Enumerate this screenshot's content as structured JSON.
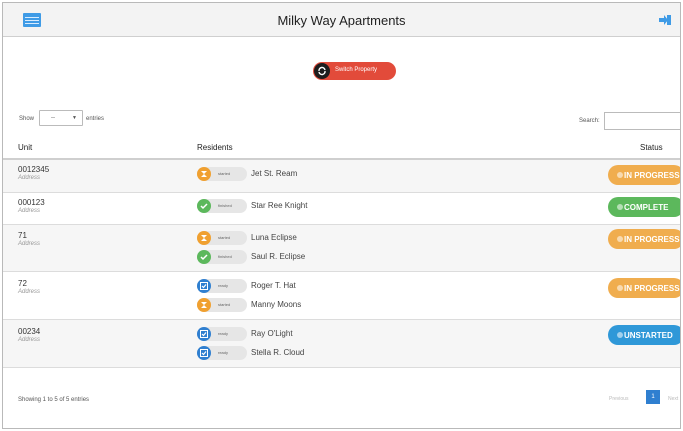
{
  "header": {
    "title": "Milky Way Apartments"
  },
  "switch_property_label": "Switch Property",
  "controls": {
    "show_label": "Show",
    "show_value": "--",
    "entries_label": "entries",
    "search_label": "Search:",
    "search_value": ""
  },
  "table": {
    "columns": [
      "Unit",
      "Residents",
      "Status"
    ],
    "rows": [
      {
        "unit": "0012345",
        "address": "Address",
        "residents": [
          {
            "state": "started",
            "name": "Jet St. Ream"
          }
        ],
        "status": "IN PROGRESS"
      },
      {
        "unit": "000123",
        "address": "Address",
        "residents": [
          {
            "state": "finished",
            "name": "Star Ree Knight"
          }
        ],
        "status": "COMPLETE"
      },
      {
        "unit": "71",
        "address": "Address",
        "residents": [
          {
            "state": "started",
            "name": "Luna Eclipse"
          },
          {
            "state": "finished",
            "name": "Saul R. Eclipse"
          }
        ],
        "status": "IN PROGRESS"
      },
      {
        "unit": "72",
        "address": "Address",
        "residents": [
          {
            "state": "ready",
            "name": "Roger T. Hat"
          },
          {
            "state": "started",
            "name": "Manny Moons"
          }
        ],
        "status": "IN PROGRESS"
      },
      {
        "unit": "00234",
        "address": "Address",
        "residents": [
          {
            "state": "ready",
            "name": "Ray O'Light"
          },
          {
            "state": "ready",
            "name": "Stella R. Cloud"
          }
        ],
        "status": "UNSTARTED"
      }
    ]
  },
  "footer": {
    "info": "Showing 1 to 5 of 5 entries",
    "previous": "Previous",
    "current_page": "1",
    "next": "Next"
  },
  "colors": {
    "in_progress": "#f0ad4e",
    "complete": "#5cb85c",
    "unstarted": "#2f98d8",
    "switch_button": "#e24b3a",
    "accent": "#2f7fd0"
  },
  "icons": {
    "menu": "menu-icon",
    "logout": "logout-icon",
    "switch": "refresh-icon",
    "started": "hourglass-icon",
    "finished": "check-icon",
    "ready": "checkbox-icon"
  }
}
